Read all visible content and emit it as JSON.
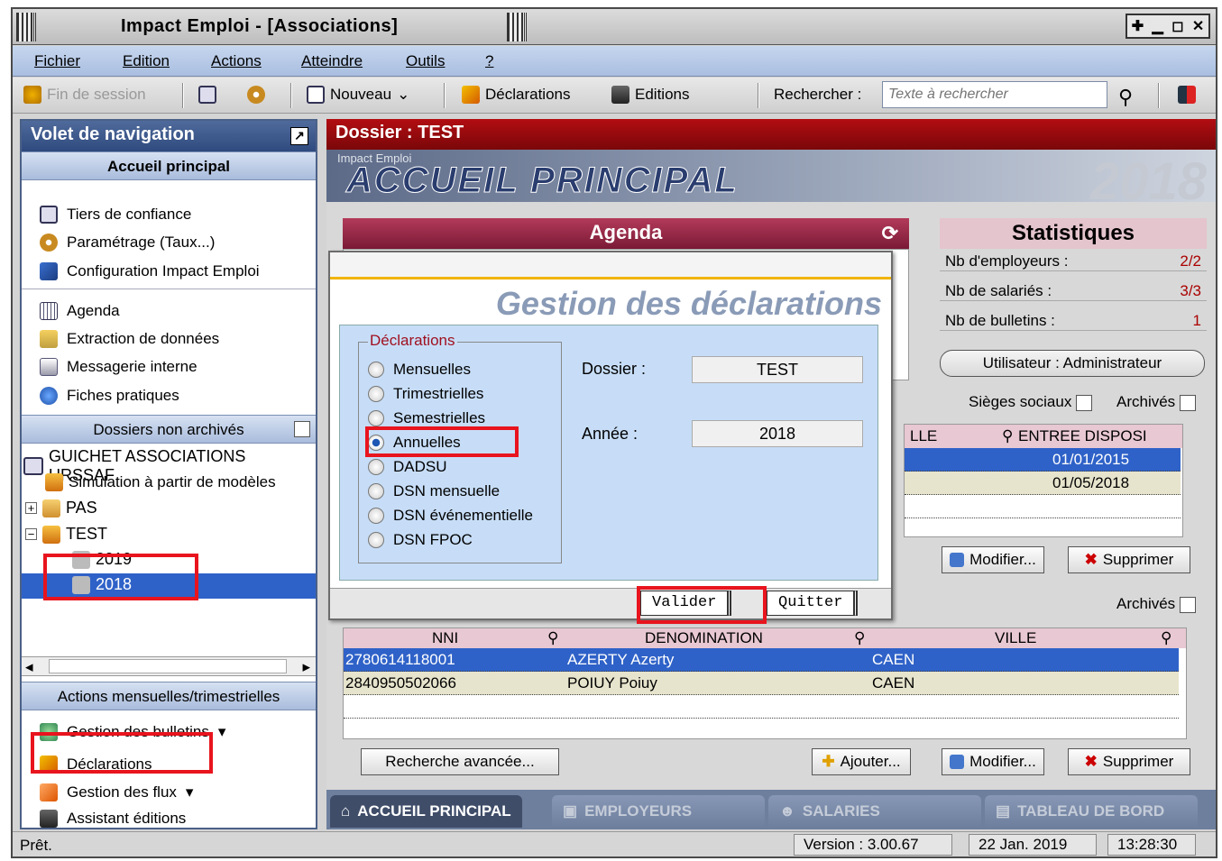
{
  "window": {
    "title": "Impact Emploi - [Associations]",
    "controls": [
      "✚",
      "▁",
      "◻",
      "✕"
    ]
  },
  "menu": [
    "Fichier",
    "Edition",
    "Actions",
    "Atteindre",
    "Outils",
    "?"
  ],
  "toolbar": {
    "end_session": "Fin de session",
    "new": "Nouveau",
    "declarations": "Déclarations",
    "editions": "Editions",
    "search_label": "Rechercher :",
    "search_placeholder": "Texte à rechercher"
  },
  "nav": {
    "header": "Volet de navigation",
    "home_section": "Accueil principal",
    "items_group1": [
      "Tiers de confiance",
      "Paramétrage (Taux...)",
      "Configuration Impact Emploi"
    ],
    "items_group2": [
      "Agenda",
      "Extraction de données",
      "Messagerie interne",
      "Fiches pratiques"
    ],
    "dossiers_section": "Dossiers non archivés",
    "tree": [
      "GUICHET ASSOCIATIONS URSSAF",
      "Simulation à partir de modèles",
      "PAS",
      "TEST",
      "2019",
      "2018"
    ],
    "actions_section": "Actions mensuelles/trimestrielles",
    "actions": [
      "Gestion des bulletins",
      "Déclarations",
      "Gestion des flux",
      "Assistant éditions"
    ]
  },
  "main": {
    "dossier": "Dossier : TEST",
    "banner_app": "Impact Emploi",
    "banner_title": "ACCUEIL PRINCIPAL",
    "banner_year": "2018",
    "agenda": "Agenda",
    "stats_title": "Statistiques",
    "stats": [
      {
        "label": "Nb d'employeurs :",
        "value": "2/2"
      },
      {
        "label": "Nb de salariés :",
        "value": "3/3"
      },
      {
        "label": "Nb de bulletins :",
        "value": "1"
      }
    ],
    "user": "Utilisateur : Administrateur",
    "sieges": "Sièges sociaux",
    "archives": "Archivés",
    "emp_cols": [
      "LLE",
      "ENTREE DISPOSI"
    ],
    "emp_rows": [
      [
        "01/01/2015"
      ],
      [
        "01/05/2018"
      ]
    ],
    "modifier": "Modifier...",
    "supprimer": "Supprimer",
    "ajouter": "Ajouter...",
    "recherche": "Recherche avancée...",
    "sal_cols": [
      "NNI",
      "DENOMINATION",
      "VILLE"
    ],
    "sal_rows": [
      [
        "2780614118001",
        "AZERTY Azerty",
        "CAEN"
      ],
      [
        "2840950502066",
        "POIUY Poiuy",
        "CAEN"
      ]
    ],
    "tabs": [
      "ACCUEIL PRINCIPAL",
      "EMPLOYEURS",
      "SALARIES",
      "TABLEAU DE BORD"
    ]
  },
  "dialog": {
    "title": "Gestion des déclarations",
    "group": "Déclarations",
    "options": [
      "Mensuelles",
      "Trimestrielles",
      "Semestrielles",
      "Annuelles",
      "DADSU",
      "DSN mensuelle",
      "DSN événementielle",
      "DSN FPOC"
    ],
    "selected": "Annuelles",
    "dossier_label": "Dossier :",
    "dossier_value": "TEST",
    "annee_label": "Année :",
    "annee_value": "2018",
    "valider": "Valider",
    "quitter": "Quitter"
  },
  "status": {
    "ready": "Prêt.",
    "version": "Version : 3.00.67",
    "date": "22 Jan. 2019",
    "time": "13:28:30"
  }
}
